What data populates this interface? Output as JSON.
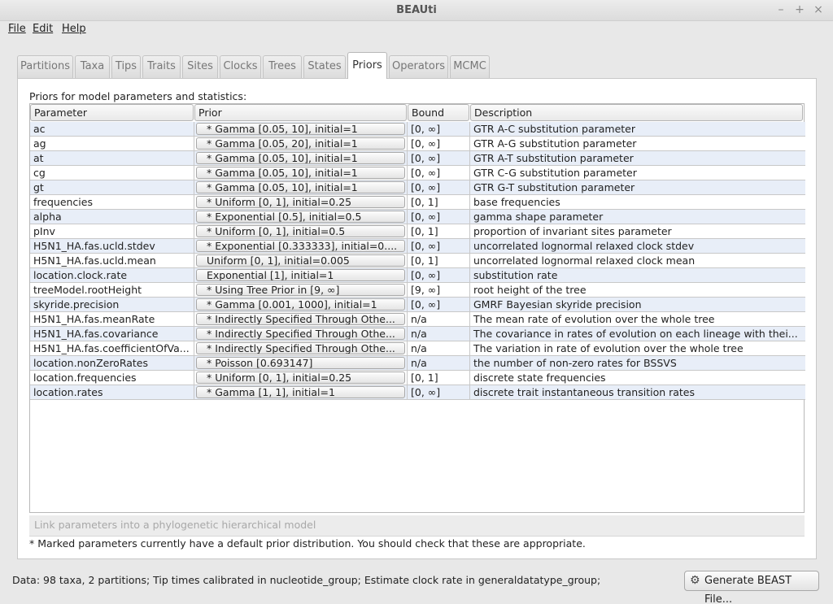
{
  "window": {
    "title": "BEAUti",
    "minimize": "–",
    "maximize": "+",
    "close": "×"
  },
  "menu": {
    "file": "File",
    "edit": "Edit",
    "help": "Help"
  },
  "tabs": [
    "Partitions",
    "Taxa",
    "Tips",
    "Traits",
    "Sites",
    "Clocks",
    "Trees",
    "States",
    "Priors",
    "Operators",
    "MCMC"
  ],
  "active_tab": "Priors",
  "panel": {
    "heading": "Priors for model parameters and statistics:",
    "columns": [
      "Parameter",
      "Prior",
      "Bound",
      "Description"
    ],
    "rows": [
      {
        "param": "ac",
        "prior": "* Gamma [0.05, 10], initial=1",
        "bound": "[0, ∞]",
        "desc": "GTR A-C substitution parameter"
      },
      {
        "param": "ag",
        "prior": "* Gamma [0.05, 20], initial=1",
        "bound": "[0, ∞]",
        "desc": "GTR A-G substitution parameter"
      },
      {
        "param": "at",
        "prior": "* Gamma [0.05, 10], initial=1",
        "bound": "[0, ∞]",
        "desc": "GTR A-T substitution parameter"
      },
      {
        "param": "cg",
        "prior": "* Gamma [0.05, 10], initial=1",
        "bound": "[0, ∞]",
        "desc": "GTR C-G substitution parameter"
      },
      {
        "param": "gt",
        "prior": "* Gamma [0.05, 10], initial=1",
        "bound": "[0, ∞]",
        "desc": "GTR G-T substitution parameter"
      },
      {
        "param": "frequencies",
        "prior": "* Uniform [0, 1], initial=0.25",
        "bound": "[0, 1]",
        "desc": "base frequencies"
      },
      {
        "param": "alpha",
        "prior": "* Exponential [0.5], initial=0.5",
        "bound": "[0, ∞]",
        "desc": "gamma shape parameter"
      },
      {
        "param": "pInv",
        "prior": "* Uniform [0, 1], initial=0.5",
        "bound": "[0, 1]",
        "desc": "proportion of invariant sites parameter"
      },
      {
        "param": "H5N1_HA.fas.ucld.stdev",
        "prior": "* Exponential [0.333333], initial=0....",
        "bound": "[0, ∞]",
        "desc": "uncorrelated lognormal relaxed clock stdev"
      },
      {
        "param": "H5N1_HA.fas.ucld.mean",
        "prior": "Uniform [0, 1], initial=0.005",
        "bound": "[0, 1]",
        "desc": "uncorrelated lognormal relaxed clock mean"
      },
      {
        "param": "location.clock.rate",
        "prior": "Exponential [1], initial=1",
        "bound": "[0, ∞]",
        "desc": "substitution rate"
      },
      {
        "param": "treeModel.rootHeight",
        "prior": "* Using Tree Prior in [9, ∞]",
        "bound": "[9, ∞]",
        "desc": "root height of the tree"
      },
      {
        "param": "skyride.precision",
        "prior": "* Gamma [0.001, 1000], initial=1",
        "bound": "[0, ∞]",
        "desc": "GMRF Bayesian skyride precision"
      },
      {
        "param": "H5N1_HA.fas.meanRate",
        "prior": "* Indirectly Specified Through Othe...",
        "bound": "n/a",
        "desc": "The mean rate of evolution over the whole tree"
      },
      {
        "param": "H5N1_HA.fas.covariance",
        "prior": "* Indirectly Specified Through Othe...",
        "bound": "n/a",
        "desc": "The covariance in rates of evolution on each lineage with thei..."
      },
      {
        "param": "H5N1_HA.fas.coefficientOfVa...",
        "prior": "* Indirectly Specified Through Othe...",
        "bound": "n/a",
        "desc": "The variation in rate of evolution over the whole tree"
      },
      {
        "param": "location.nonZeroRates",
        "prior": "* Poisson [0.693147]",
        "bound": "n/a",
        "desc": "the number of non-zero rates for BSSVS"
      },
      {
        "param": "location.frequencies",
        "prior": "* Uniform [0, 1], initial=0.25",
        "bound": "[0, 1]",
        "desc": "discrete state frequencies"
      },
      {
        "param": "location.rates",
        "prior": "* Gamma [1, 1], initial=1",
        "bound": "[0, ∞]",
        "desc": "discrete trait instantaneous transition rates"
      }
    ],
    "link_label": "Link parameters into a phylogenetic hierarchical model",
    "footnote": "* Marked parameters currently have a default prior distribution. You should check that these are appropriate."
  },
  "status": "Data: 98 taxa, 2 partitions; Tip times calibrated in nucleotide_group; Estimate clock rate in generaldatatype_group;",
  "generate_button": "Generate BEAST File...",
  "icons": {
    "gear": "gear-icon"
  }
}
